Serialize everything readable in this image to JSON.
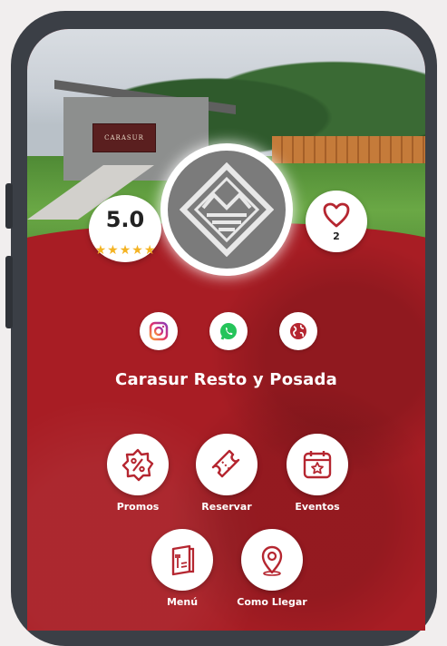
{
  "business": {
    "name": "Carasur Resto y Posada",
    "sign_text": "CARASUR"
  },
  "rating": {
    "value": "5.0",
    "stars": 5
  },
  "likes": {
    "count": "2"
  },
  "social": [
    {
      "icon": "instagram-icon"
    },
    {
      "icon": "whatsapp-icon"
    },
    {
      "icon": "globe-icon"
    }
  ],
  "actions": {
    "promos": "Promos",
    "reservar": "Reservar",
    "eventos": "Eventos",
    "menu": "Menú",
    "como_llegar": "Como Llegar"
  },
  "colors": {
    "brand_red": "#a81d24",
    "icon_red": "#b52630",
    "star": "#f4b323"
  }
}
